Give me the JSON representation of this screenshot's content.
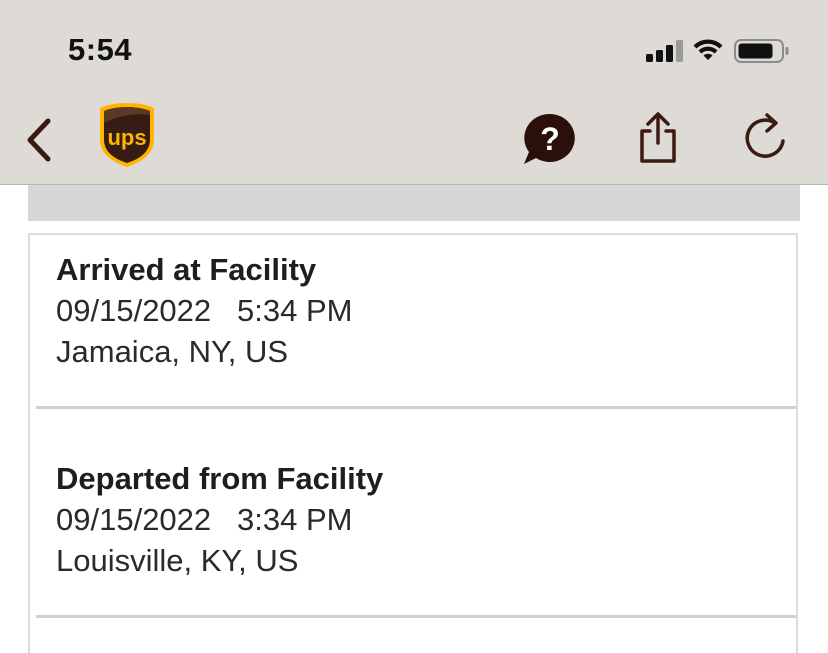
{
  "status_bar": {
    "time": "5:54",
    "icons": [
      "cellular-signal-icon",
      "wifi-icon",
      "battery-icon"
    ]
  },
  "nav": {
    "back_icon": "chevron-left-icon",
    "logo_text": "ups",
    "help_icon": "question-chat-icon",
    "share_icon": "share-icon",
    "refresh_icon": "refresh-icon"
  },
  "events": [
    {
      "status": "Arrived at Facility",
      "date": "09/15/2022",
      "time": "5:34 PM",
      "location": "Jamaica, NY, US"
    },
    {
      "status": "Departed from Facility",
      "date": "09/15/2022",
      "time": "3:34 PM",
      "location": "Louisville, KY, US"
    }
  ],
  "colors": {
    "header_bg": "#dedbd6",
    "ups_brown": "#351c15",
    "ups_gold": "#ffb500"
  }
}
